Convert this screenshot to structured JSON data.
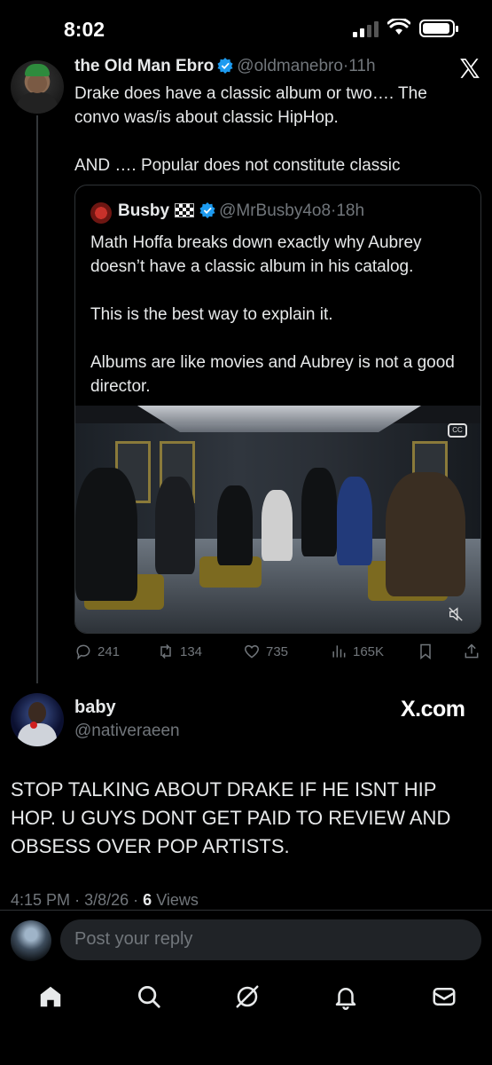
{
  "status_bar": {
    "time": "8:02"
  },
  "main_tweet": {
    "author_name": "the Old Man Ebro",
    "handle": "@oldmanebro",
    "separator": "·",
    "time_ago": "11h",
    "text": "Drake does have a classic album or two…. The convo was/is about classic HipHop.\n\nAND …. Popular does not constitute classic"
  },
  "quoted_tweet": {
    "author_name": "Busby",
    "handle": "@MrBusby4o8",
    "separator": "·",
    "time_ago": "18h",
    "text": "Math Hoffa breaks down exactly why Aubrey doesn’t have a classic album in his catalog.\n\nThis is the best way to explain it.\n\nAlbums are like movies and Aubrey is not a good director.",
    "media_icons": [
      "captions-icon",
      "mute-icon"
    ]
  },
  "actions": {
    "replies": "241",
    "reposts": "134",
    "likes": "735",
    "views": "165K"
  },
  "reply_tweet": {
    "author_name": "baby",
    "handle": "@nativeraeen",
    "watermark": "X.com",
    "text": "STOP TALKING ABOUT DRAKE IF HE ISNT HIP HOP. U GUYS DONT GET PAID TO REVIEW AND OBSESS OVER  POP ARTISTS.",
    "time": "4:15 PM",
    "date": "3/8/26",
    "separator": "·",
    "views_count": "6",
    "views_label": "Views"
  },
  "composer": {
    "placeholder": "Post your reply"
  },
  "nav": [
    "home-icon",
    "search-icon",
    "grok-icon",
    "notifications-icon",
    "messages-icon"
  ],
  "colors": {
    "background": "#000000",
    "text": "#e7e9ea",
    "muted": "#71767b",
    "verified": "#1d9bf0"
  }
}
